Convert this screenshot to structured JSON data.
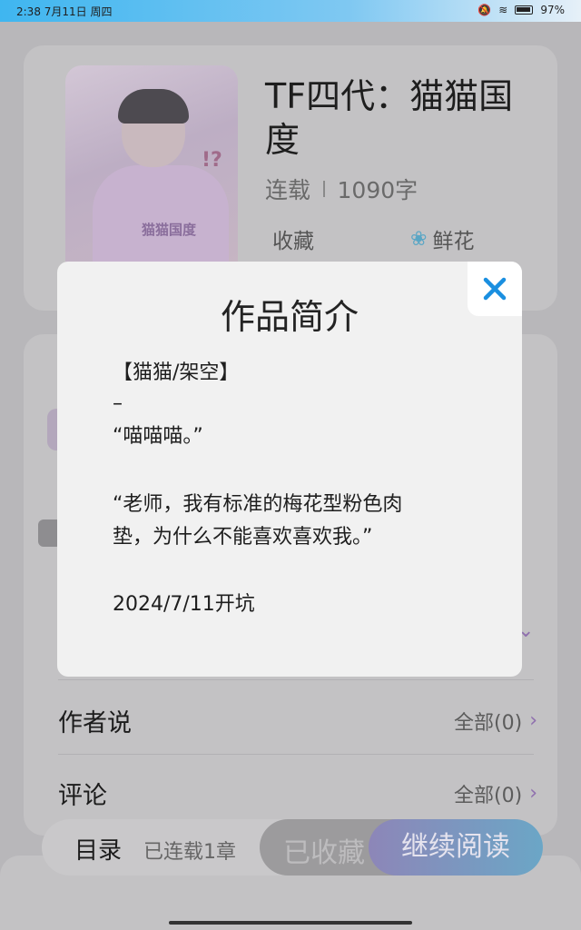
{
  "statusbar": {
    "time": "2:38 7月11日 周四",
    "battery": "97%"
  },
  "book": {
    "title": "TF四代：猫猫国度",
    "status": "连载",
    "word_count": "1090字",
    "collect_label": "收藏",
    "flower_label": "鲜花",
    "cover_tag": "猫猫国度",
    "cover_mark": "!?"
  },
  "modal": {
    "title": "作品简介",
    "lines": [
      "【猫猫/架空】",
      "–",
      "“喵喵喵。”",
      "“老师，我有标准的梅花型粉色肉",
      "垫，为什么不能喜欢喜欢我。”",
      "2024/7/11开坑"
    ]
  },
  "sections": {
    "author_say": {
      "label": "作者说",
      "all": "全部(0)"
    },
    "comments": {
      "label": "评论",
      "all": "全部(0)"
    }
  },
  "bottom": {
    "toc": "目录",
    "chapters": "已连载1章",
    "collected": "已收藏",
    "continue": "继续阅读"
  },
  "icons": {
    "close": "close-icon",
    "flower": "flower-icon",
    "chevron": "chevron-right-icon"
  },
  "colors": {
    "close_accent": "#1a8fe0",
    "chevron_accent": "#8f6fae"
  }
}
